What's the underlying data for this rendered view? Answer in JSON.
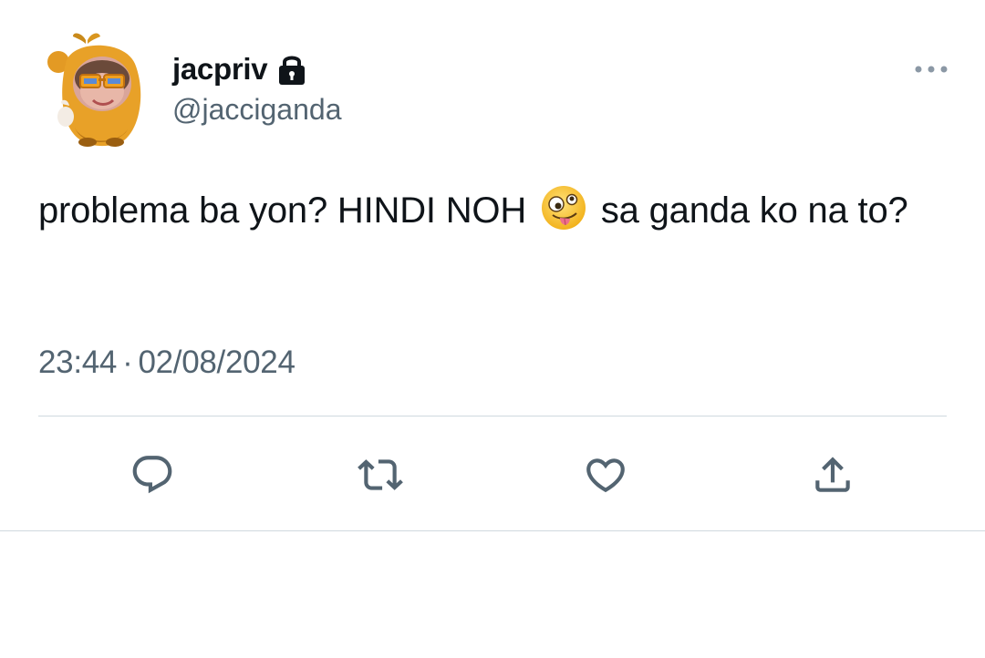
{
  "author": {
    "display_name": "jacpriv",
    "handle": "@jacciganda",
    "protected_icon": "lock-icon",
    "avatar_icon": "character-avatar"
  },
  "tweet": {
    "text_before_emoji": "problema ba yon? HINDI NOH",
    "emoji": "zany-face-emoji",
    "text_after_emoji": "sa ganda ko na to?",
    "time": "23:44",
    "separator": "·",
    "date": "02/08/2024"
  },
  "actions": [
    {
      "name": "reply",
      "icon": "reply-icon"
    },
    {
      "name": "retweet",
      "icon": "retweet-icon"
    },
    {
      "name": "like",
      "icon": "heart-icon"
    },
    {
      "name": "share",
      "icon": "share-icon"
    }
  ],
  "colors": {
    "text_primary": "#0f1419",
    "text_secondary": "#536471",
    "divider": "#cfd9de",
    "background": "#ffffff"
  }
}
